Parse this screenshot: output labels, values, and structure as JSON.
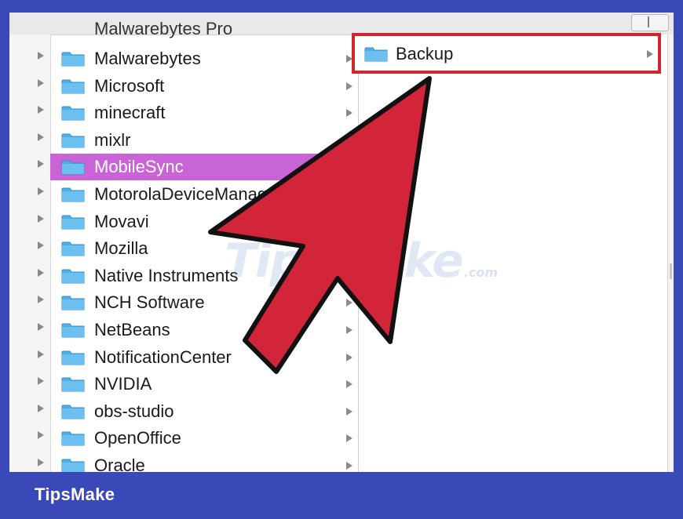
{
  "top_strip": {
    "partial_item_label": "Malwarebytes Pro"
  },
  "column_1": {
    "rows": [
      {
        "label": "Malwarebytes",
        "selected": false,
        "has_chevron": true
      },
      {
        "label": "Microsoft",
        "selected": false,
        "has_chevron": true
      },
      {
        "label": "minecraft",
        "selected": false,
        "has_chevron": true
      },
      {
        "label": "mixlr",
        "selected": false,
        "has_chevron": true
      },
      {
        "label": "MobileSync",
        "selected": true,
        "has_chevron": false
      },
      {
        "label": "MotorolaDeviceManager",
        "selected": false,
        "has_chevron": false
      },
      {
        "label": "Movavi",
        "selected": false,
        "has_chevron": false
      },
      {
        "label": "Mozilla",
        "selected": false,
        "has_chevron": false
      },
      {
        "label": "Native Instruments",
        "selected": false,
        "has_chevron": false
      },
      {
        "label": "NCH Software",
        "selected": false,
        "has_chevron": true
      },
      {
        "label": "NetBeans",
        "selected": false,
        "has_chevron": true
      },
      {
        "label": "NotificationCenter",
        "selected": false,
        "has_chevron": true
      },
      {
        "label": "NVIDIA",
        "selected": false,
        "has_chevron": true
      },
      {
        "label": "obs-studio",
        "selected": false,
        "has_chevron": true
      },
      {
        "label": "OpenOffice",
        "selected": false,
        "has_chevron": true
      },
      {
        "label": "Oracle",
        "selected": false,
        "has_chevron": true
      }
    ]
  },
  "column_2": {
    "rows": [
      {
        "label": "Backup",
        "highlighted": true
      }
    ]
  },
  "annotation": {
    "arrow_icon": "pointer-arrow-icon",
    "highlight_color": "#d2252f",
    "arrow_fill": "#d2253a"
  },
  "watermark": {
    "text": "TipsMake",
    "suffix": ".com"
  },
  "footer": {
    "brand": "TipsMake"
  },
  "colors": {
    "frame_blue": "#3a48b8",
    "selection": "#c864d6",
    "folder_blue": "#4faee8"
  }
}
